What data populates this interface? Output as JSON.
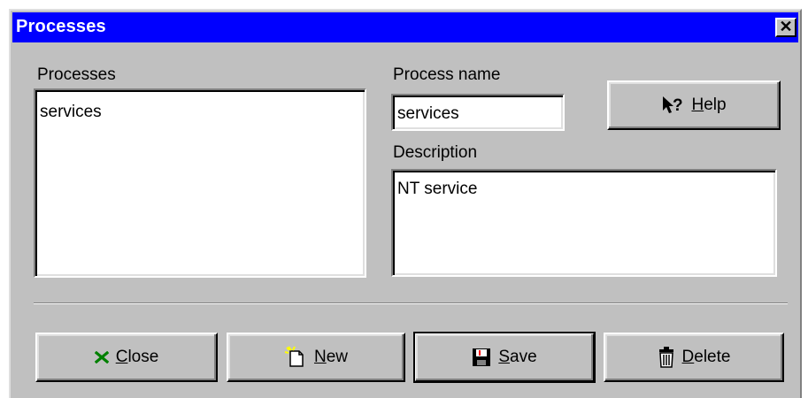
{
  "window": {
    "title": "Processes"
  },
  "labels": {
    "processes": "Processes",
    "process_name": "Process name",
    "description": "Description"
  },
  "processes_list": [
    "services"
  ],
  "fields": {
    "process_name_value": "services",
    "description_value": "NT service"
  },
  "buttons": {
    "help": {
      "mnemonic": "H",
      "rest": "elp",
      "icon": "whats-this-help-icon"
    },
    "close": {
      "mnemonic": "C",
      "rest": "lose",
      "icon": "green-x-icon"
    },
    "new": {
      "mnemonic": "N",
      "rest": "ew",
      "icon": "new-document-icon"
    },
    "save": {
      "mnemonic": "S",
      "rest": "ave",
      "icon": "floppy-disk-icon"
    },
    "delete": {
      "mnemonic": "D",
      "rest": "elete",
      "icon": "trash-can-icon"
    }
  },
  "colors": {
    "titlebar": "#0000ff",
    "face": "#c0c0c0",
    "close_x": "#008000"
  }
}
